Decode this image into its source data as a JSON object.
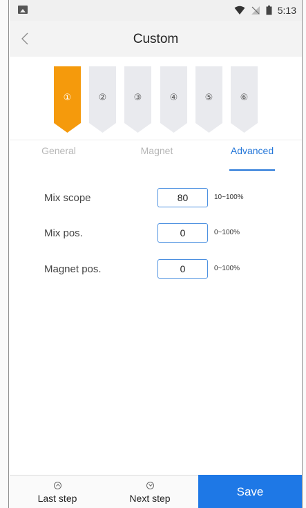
{
  "status_bar": {
    "time": "5:13",
    "icons": [
      "image-icon",
      "wifi-icon",
      "no-signal-icon",
      "battery-icon"
    ]
  },
  "header": {
    "back_icon": "chevron-left-icon",
    "title": "Custom"
  },
  "steps": [
    {
      "label": "①",
      "active": true
    },
    {
      "label": "②",
      "active": false
    },
    {
      "label": "③",
      "active": false
    },
    {
      "label": "④",
      "active": false
    },
    {
      "label": "⑤",
      "active": false
    },
    {
      "label": "⑥",
      "active": false
    }
  ],
  "tabs": [
    {
      "label": "General",
      "active": false
    },
    {
      "label": "Magnet",
      "active": false
    },
    {
      "label": "Advanced",
      "active": true
    }
  ],
  "form": {
    "fields": [
      {
        "label": "Mix scope",
        "value": "80",
        "range": "10~100%"
      },
      {
        "label": "Mix pos.",
        "value": "0",
        "range": "0~100%"
      },
      {
        "label": "Magnet pos.",
        "value": "0",
        "range": "0~100%"
      }
    ]
  },
  "footer": {
    "last_step": "Last step",
    "next_step": "Next step",
    "save": "Save"
  },
  "colors": {
    "accent": "#2476d8",
    "active_step": "#f59a0c",
    "inactive_step": "#e9eaee",
    "save_button": "#1e78e6"
  }
}
